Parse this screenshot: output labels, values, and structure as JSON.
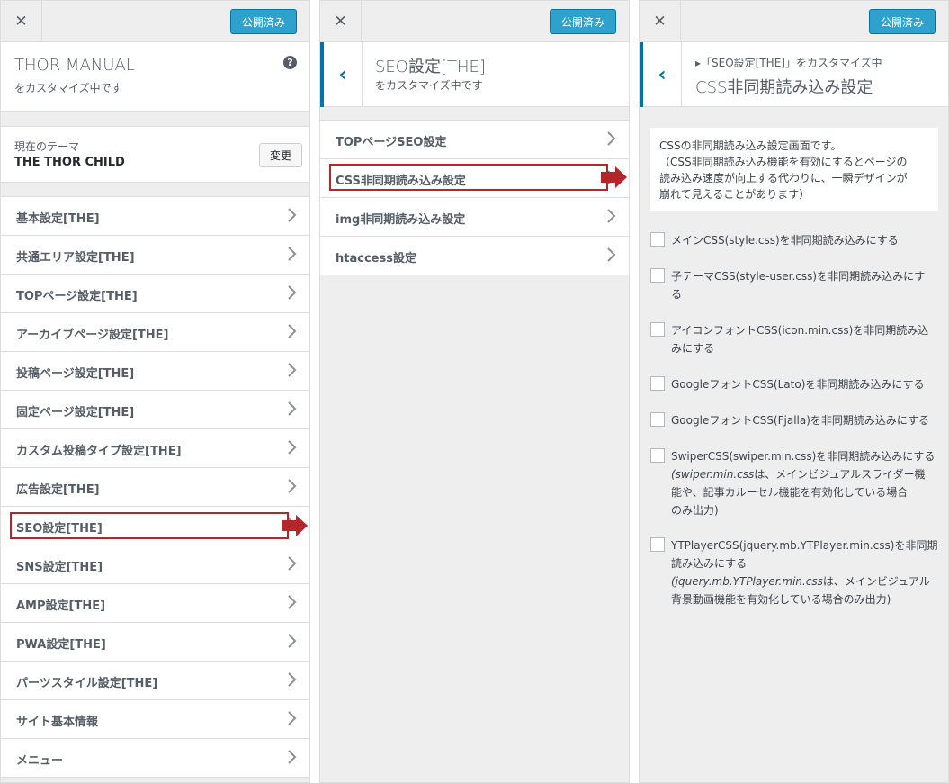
{
  "left_panel": {
    "close_label": "✕",
    "publish_label": "公開済み",
    "site_title": "THOR MANUAL",
    "customizing": "をカスタマイズ中です",
    "help_label": "?",
    "theme_label": "現在のテーマ",
    "theme_name": "THE THOR CHILD",
    "change_label": "変更",
    "items": [
      {
        "label": "基本設定[THE]"
      },
      {
        "label": "共通エリア設定[THE]"
      },
      {
        "label": "TOPページ設定[THE]"
      },
      {
        "label": "アーカイブページ設定[THE]"
      },
      {
        "label": "投稿ページ設定[THE]"
      },
      {
        "label": "固定ページ設定[THE]"
      },
      {
        "label": "カスタム投稿タイプ設定[THE]"
      },
      {
        "label": "広告設定[THE]"
      },
      {
        "label": "SEO設定[THE]"
      },
      {
        "label": "SNS設定[THE]"
      },
      {
        "label": "AMP設定[THE]"
      },
      {
        "label": "PWA設定[THE]"
      },
      {
        "label": "パーツスタイル設定[THE]"
      },
      {
        "label": "サイト基本情報"
      },
      {
        "label": "メニュー"
      }
    ]
  },
  "middle_panel": {
    "close_label": "✕",
    "publish_label": "公開済み",
    "back_label": "‹",
    "title": "SEO設定[THE]",
    "customizing": "をカスタマイズ中です",
    "items": [
      {
        "label": "TOPページSEO設定"
      },
      {
        "label": "CSS非同期読み込み設定"
      },
      {
        "label": "img非同期読み込み設定"
      },
      {
        "label": "htaccess設定"
      }
    ]
  },
  "right_panel": {
    "close_label": "✕",
    "publish_label": "公開済み",
    "back_label": "‹",
    "breadcrumb": "▸「SEO設定[THE]」をカスタマイズ中",
    "title": "CSS非同期読み込み設定",
    "description": [
      "CSSの非同期読み込み設定画面です。",
      "（CSS非同期読み込み機能を有効にするとページの",
      "読み込み速度が向上する代わりに、一瞬デザインが",
      "崩れて見えることがあります）"
    ],
    "options": [
      {
        "line1": "メインCSS(style.css)を非同期読み込みにする"
      },
      {
        "line1": "子テーマCSS(style-user.css)を非同期読み込みにす",
        "line2": "る"
      },
      {
        "line1": "アイコンフォントCSS(icon.min.css)を非同期読み込",
        "line2": "みにする"
      },
      {
        "line1": "GoogleフォントCSS(Lato)を非同期読み込みにする"
      },
      {
        "line1": "GoogleフォントCSS(Fjalla)を非同期読み込みにする"
      },
      {
        "line1": "SwiperCSS(swiper.min.css)を非同期読み込みにする",
        "note1": "(swiper.min.css",
        "note1b": "は、メインビジュアルスライダー機",
        "note2": "能や、記事カルーセル機能を有効化している場合",
        "note3": "のみ出力)"
      },
      {
        "line1": "YTPlayerCSS(jquery.mb.YTPlayer.min.css)を非同期",
        "line2": "読み込みにする",
        "note1": "(jquery.mb.YTPlayer.min.css",
        "note1b": "は、メインビジュアル",
        "note2": "背景動画機能を有効化している場合のみ出力)"
      }
    ]
  },
  "colors": {
    "accent": "#0073aa",
    "publish": "#2ea2cc",
    "highlight": "#b5262a"
  }
}
